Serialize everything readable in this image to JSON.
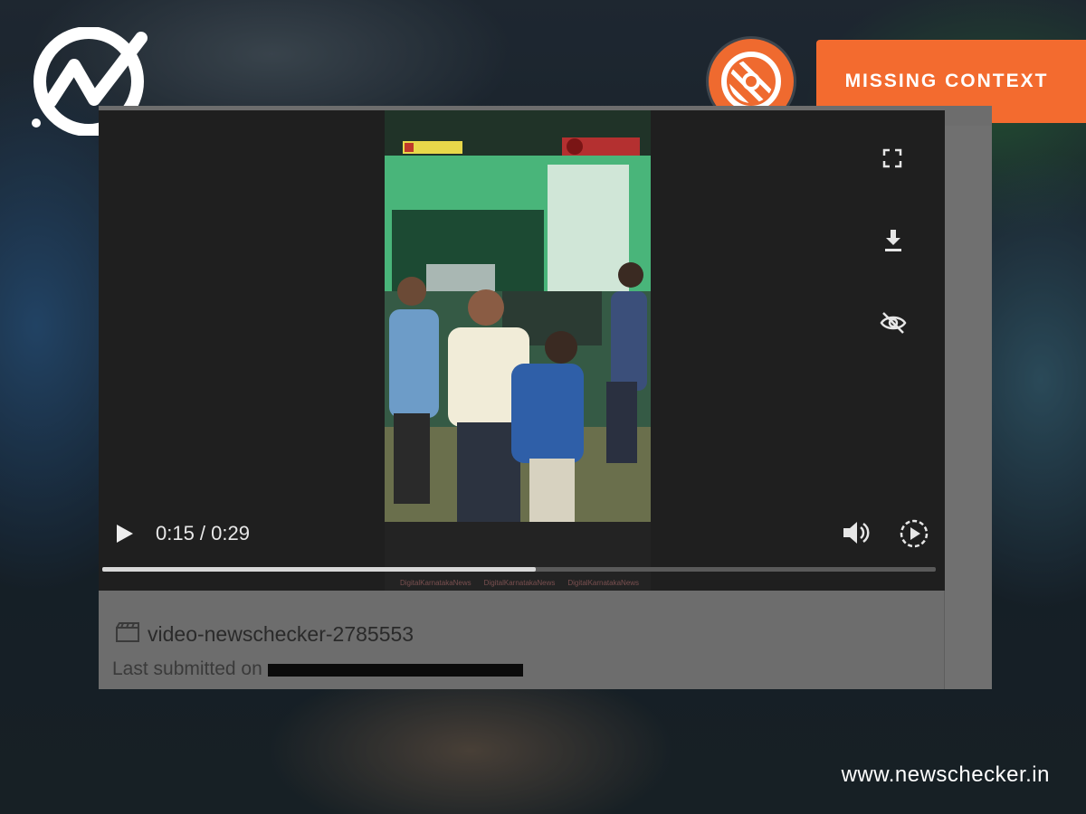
{
  "overlay": {
    "badge_label": "MISSING CONTEXT",
    "site_url": "www.newschecker.in",
    "accent_color": "#f36b2f",
    "logo_icon": "newschecker-logo-icon",
    "badge_icon": "magnifier-stripes-icon"
  },
  "player": {
    "time_display": "0:15 / 0:29",
    "progress": 0.52,
    "controls": [
      "play-icon",
      "volume-icon",
      "playback-speed-icon",
      "fullscreen-icon",
      "download-icon",
      "hide-icon"
    ],
    "watermark_items": [
      "DigitalKarnatakaNews",
      "DigitalKarnatakaNews",
      "DigitalKarnatakaNews"
    ]
  },
  "file": {
    "name": "video-newschecker-2785553",
    "submitted_prefix": "Last submitted on"
  }
}
